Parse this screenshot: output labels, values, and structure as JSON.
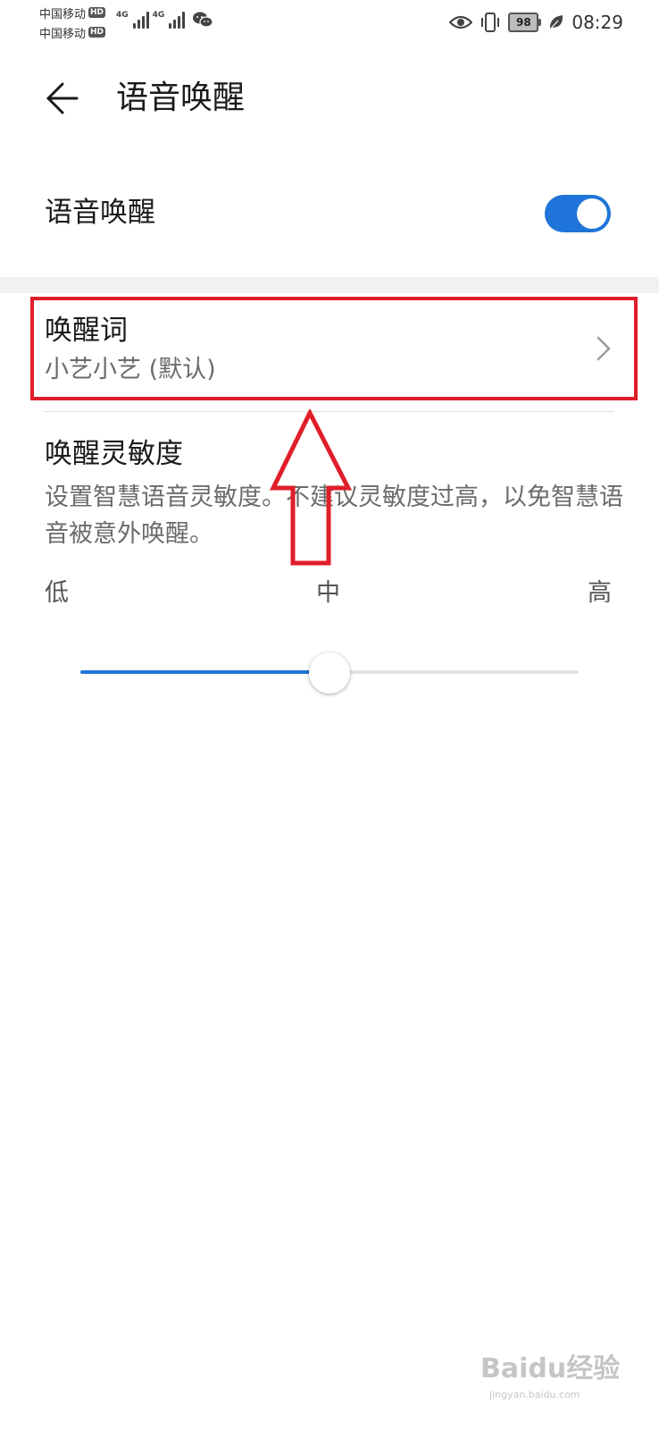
{
  "status_bar": {
    "carrier_1": "中国移动",
    "carrier_2": "中国移动",
    "hd_badge": "HD",
    "network_type": "4G",
    "battery": "98",
    "time": "08:29",
    "icons": [
      "signal-icon",
      "wechat-icon",
      "eye-icon",
      "vibrate-icon",
      "battery-icon",
      "leaf-icon"
    ]
  },
  "header": {
    "title": "语音唤醒",
    "back_icon": "arrow-left-icon"
  },
  "voice_wake": {
    "label": "语音唤醒",
    "enabled": true,
    "accent_color": "#1e74d8"
  },
  "wake_word": {
    "title": "唤醒词",
    "value": "小艺小艺 (默认)",
    "chevron_icon": "chevron-right-icon"
  },
  "sensitivity": {
    "title": "唤醒灵敏度",
    "description": "设置智慧语音灵敏度。不建议灵敏度过高，以免智慧语音被意外唤醒。",
    "low_label": "低",
    "mid_label": "中",
    "high_label": "高",
    "level": 0.5
  },
  "annotation": {
    "highlight_color": "#e01e2a"
  },
  "watermark": {
    "main": "Baidu经验",
    "sub": "jingyan.baidu.com"
  }
}
